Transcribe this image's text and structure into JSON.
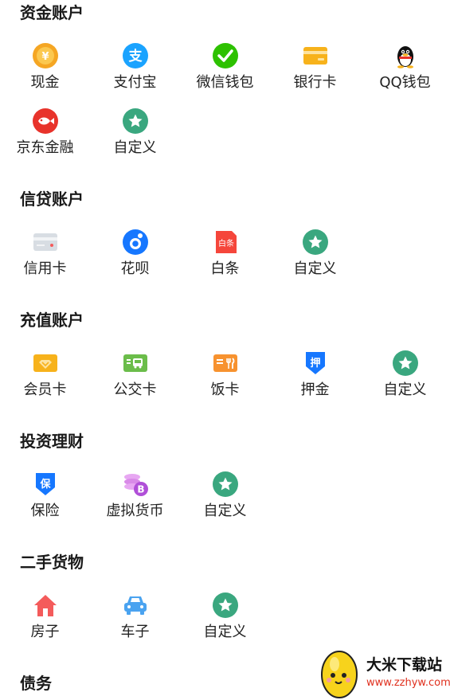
{
  "sections": [
    {
      "title": "资金账户",
      "items": [
        {
          "label": "现金",
          "icon": "coin-icon"
        },
        {
          "label": "支付宝",
          "icon": "alipay-icon"
        },
        {
          "label": "微信钱包",
          "icon": "wechat-icon"
        },
        {
          "label": "银行卡",
          "icon": "bank-card-icon"
        },
        {
          "label": "QQ钱包",
          "icon": "qq-penguin-icon"
        },
        {
          "label": "京东金融",
          "icon": "jd-fish-icon"
        },
        {
          "label": "自定义",
          "icon": "star-icon"
        }
      ]
    },
    {
      "title": "信贷账户",
      "items": [
        {
          "label": "信用卡",
          "icon": "credit-card-icon"
        },
        {
          "label": "花呗",
          "icon": "huabei-icon"
        },
        {
          "label": "白条",
          "icon": "baitiao-icon",
          "icon_text": "白条"
        },
        {
          "label": "自定义",
          "icon": "star-icon"
        }
      ]
    },
    {
      "title": "充值账户",
      "items": [
        {
          "label": "会员卡",
          "icon": "member-card-icon"
        },
        {
          "label": "公交卡",
          "icon": "bus-card-icon"
        },
        {
          "label": "饭卡",
          "icon": "meal-card-icon"
        },
        {
          "label": "押金",
          "icon": "deposit-icon",
          "icon_text": "押"
        },
        {
          "label": "自定义",
          "icon": "star-icon"
        }
      ]
    },
    {
      "title": "投资理财",
      "items": [
        {
          "label": "保险",
          "icon": "insurance-icon",
          "icon_text": "保"
        },
        {
          "label": "虚拟货币",
          "icon": "crypto-coins-icon",
          "icon_text": "B"
        },
        {
          "label": "自定义",
          "icon": "star-icon"
        }
      ]
    },
    {
      "title": "二手货物",
      "items": [
        {
          "label": "房子",
          "icon": "house-icon"
        },
        {
          "label": "车子",
          "icon": "car-icon"
        },
        {
          "label": "自定义",
          "icon": "star-icon"
        }
      ]
    },
    {
      "title": "债务",
      "items": []
    }
  ],
  "watermark": {
    "title": "大米下载站",
    "url": "www.zzhyw.com"
  },
  "colors": {
    "coin": "#f5a623",
    "alipay": "#1aa3ff",
    "wechat": "#2dc100",
    "bank": "#f7b21b",
    "jd": "#e8332b",
    "star": "#3aa77f",
    "credit": "#d8dde3",
    "huabei": "#1677ff",
    "baitiao": "#f5463b",
    "member": "#f7b21b",
    "bus": "#6bbd4a",
    "meal": "#f7922f",
    "deposit": "#1677ff",
    "insurance": "#1677ff",
    "crypto": "#b04fd8",
    "house": "#f45b5b",
    "car": "#4aa3f0"
  }
}
